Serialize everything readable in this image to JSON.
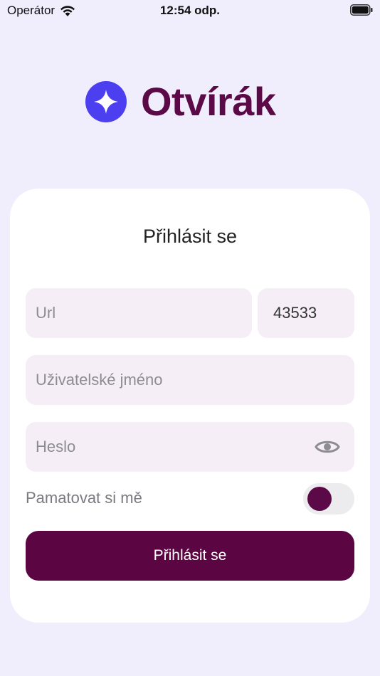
{
  "status_bar": {
    "carrier": "Operátor",
    "time": "12:54 odp."
  },
  "app": {
    "name": "Otvírák",
    "brand_color": "#5c0a47",
    "logo_mark_color": "#4b3ff0"
  },
  "login": {
    "title": "Přihlásit se",
    "url_placeholder": "Url",
    "url_value": "",
    "port_value": "43533",
    "username_placeholder": "Uživatelské jméno",
    "password_placeholder": "Heslo",
    "remember_label": "Pamatovat si mě",
    "remember_checked": false,
    "submit_label": "Přihlásit se"
  },
  "icons": {
    "wifi": "wifi-icon",
    "battery": "battery-icon",
    "logo": "sparkle-logo-icon",
    "password_toggle": "eye-icon"
  }
}
